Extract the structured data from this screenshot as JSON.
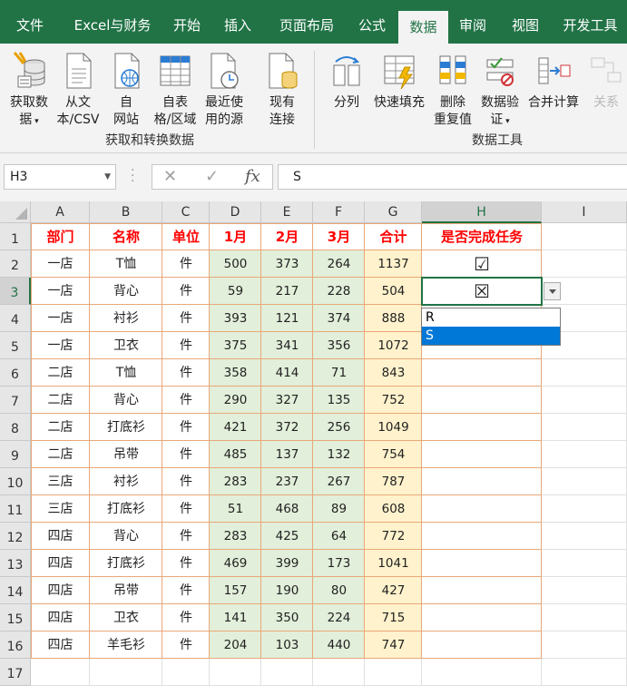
{
  "tabs": [
    {
      "label": "文件",
      "active": false
    },
    {
      "label": "Excel与财务",
      "active": false
    },
    {
      "label": "开始",
      "active": false
    },
    {
      "label": "插入",
      "active": false
    },
    {
      "label": "页面布局",
      "active": false
    },
    {
      "label": "公式",
      "active": false
    },
    {
      "label": "数据",
      "active": true
    },
    {
      "label": "审阅",
      "active": false
    },
    {
      "label": "视图",
      "active": false
    },
    {
      "label": "开发工具",
      "active": false
    }
  ],
  "ribbon": {
    "get_transform": {
      "group_label": "获取和转换数据",
      "get_data": {
        "line1": "获取数",
        "line2": "据"
      },
      "from_text": {
        "line1": "从文",
        "line2": "本/CSV"
      },
      "from_web": {
        "line1": "自",
        "line2": "网站"
      },
      "from_table": {
        "line1": "自表",
        "line2": "格/区域"
      },
      "recent_sources": {
        "line1": "最近使",
        "line2": "用的源"
      },
      "existing_connections": {
        "line1": "现有",
        "line2": "连接"
      }
    },
    "data_tools": {
      "group_label": "数据工具",
      "split": {
        "line1": "分列"
      },
      "flash_fill": {
        "line1": "快速填充"
      },
      "remove_duplicates": {
        "line1": "删除",
        "line2": "重复值"
      },
      "data_validation": {
        "line1": "数据验",
        "line2": "证"
      },
      "consolidate": {
        "line1": "合并计算"
      },
      "relationships": {
        "line1": "关系"
      }
    }
  },
  "formula_bar": {
    "name_box": "H3",
    "cancel_glyph": "✕",
    "enter_glyph": "✓",
    "fx_glyph": "fx",
    "value": "S"
  },
  "columns": [
    "A",
    "B",
    "C",
    "D",
    "E",
    "F",
    "G",
    "H",
    "I"
  ],
  "table": {
    "headers": [
      "部门",
      "名称",
      "单位",
      "1月",
      "2月",
      "3月",
      "合计",
      "是否完成任务"
    ],
    "rows": [
      [
        "一店",
        "T恤",
        "件",
        "500",
        "373",
        "264",
        "1137",
        "☑"
      ],
      [
        "一店",
        "背心",
        "件",
        "59",
        "217",
        "228",
        "504",
        "☒"
      ],
      [
        "一店",
        "衬衫",
        "件",
        "393",
        "121",
        "374",
        "888",
        ""
      ],
      [
        "一店",
        "卫衣",
        "件",
        "375",
        "341",
        "356",
        "1072",
        ""
      ],
      [
        "二店",
        "T恤",
        "件",
        "358",
        "414",
        "71",
        "843",
        ""
      ],
      [
        "二店",
        "背心",
        "件",
        "290",
        "327",
        "135",
        "752",
        ""
      ],
      [
        "二店",
        "打底衫",
        "件",
        "421",
        "372",
        "256",
        "1049",
        ""
      ],
      [
        "二店",
        "吊带",
        "件",
        "485",
        "137",
        "132",
        "754",
        ""
      ],
      [
        "三店",
        "衬衫",
        "件",
        "283",
        "237",
        "267",
        "787",
        ""
      ],
      [
        "三店",
        "打底衫",
        "件",
        "51",
        "468",
        "89",
        "608",
        ""
      ],
      [
        "四店",
        "背心",
        "件",
        "283",
        "425",
        "64",
        "772",
        ""
      ],
      [
        "四店",
        "打底衫",
        "件",
        "469",
        "399",
        "173",
        "1041",
        ""
      ],
      [
        "四店",
        "吊带",
        "件",
        "157",
        "190",
        "80",
        "427",
        ""
      ],
      [
        "四店",
        "卫衣",
        "件",
        "141",
        "350",
        "224",
        "715",
        ""
      ],
      [
        "四店",
        "羊毛衫",
        "件",
        "204",
        "103",
        "440",
        "747",
        ""
      ]
    ]
  },
  "row_numbers": [
    "1",
    "2",
    "3",
    "4",
    "5",
    "6",
    "7",
    "8",
    "9",
    "10",
    "11",
    "12",
    "13",
    "14",
    "15",
    "16",
    "17"
  ],
  "dropdown": {
    "options": [
      "R",
      "S"
    ],
    "highlighted_index": 1
  },
  "colors": {
    "accent": "#217346",
    "header_text": "#ff0000",
    "month_fill": "#e2efda",
    "total_fill": "#fff2cc",
    "table_border": "#e8a878",
    "dropdown_highlight": "#0078d7"
  }
}
